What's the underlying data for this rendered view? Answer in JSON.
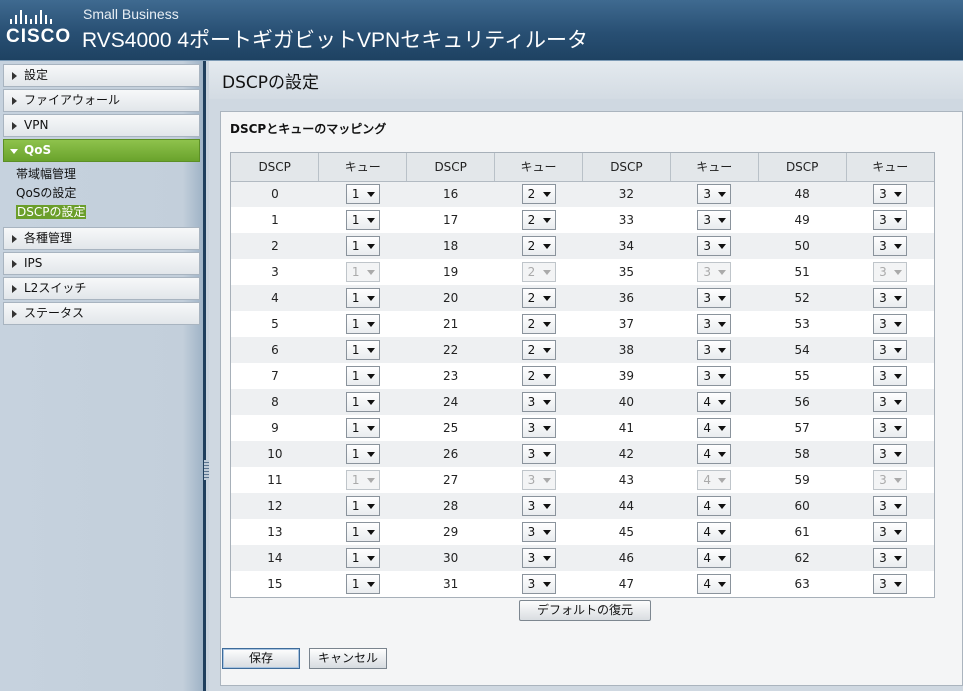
{
  "header": {
    "logo_text": "CISCO",
    "small_business": "Small Business",
    "product_title": "RVS4000 4ポートギガビットVPNセキュリティルータ"
  },
  "sidebar": {
    "items": [
      {
        "label": "設定"
      },
      {
        "label": "ファイアウォール"
      },
      {
        "label": "VPN"
      },
      {
        "label": "QoS"
      },
      {
        "label": "各種管理"
      },
      {
        "label": "IPS"
      },
      {
        "label": "L2スイッチ"
      },
      {
        "label": "ステータス"
      }
    ],
    "qos_sub": [
      {
        "label": "帯域幅管理"
      },
      {
        "label": "QoSの設定"
      },
      {
        "label": "DSCPの設定"
      }
    ]
  },
  "main": {
    "page_title": "DSCPの設定",
    "panel_title": "DSCPとキューのマッピング",
    "col_dscp": "DSCP",
    "col_queue": "キュー",
    "default_button": "デフォルトの復元",
    "save_button": "保存",
    "cancel_button": "キャンセル"
  },
  "rows": [
    {
      "cells": [
        {
          "dscp": "0",
          "q": "1",
          "disabled": false
        },
        {
          "dscp": "16",
          "q": "2",
          "disabled": false
        },
        {
          "dscp": "32",
          "q": "3",
          "disabled": false
        },
        {
          "dscp": "48",
          "q": "3",
          "disabled": false
        }
      ]
    },
    {
      "cells": [
        {
          "dscp": "1",
          "q": "1",
          "disabled": false
        },
        {
          "dscp": "17",
          "q": "2",
          "disabled": false
        },
        {
          "dscp": "33",
          "q": "3",
          "disabled": false
        },
        {
          "dscp": "49",
          "q": "3",
          "disabled": false
        }
      ]
    },
    {
      "cells": [
        {
          "dscp": "2",
          "q": "1",
          "disabled": false
        },
        {
          "dscp": "18",
          "q": "2",
          "disabled": false
        },
        {
          "dscp": "34",
          "q": "3",
          "disabled": false
        },
        {
          "dscp": "50",
          "q": "3",
          "disabled": false
        }
      ]
    },
    {
      "cells": [
        {
          "dscp": "3",
          "q": "1",
          "disabled": true
        },
        {
          "dscp": "19",
          "q": "2",
          "disabled": true
        },
        {
          "dscp": "35",
          "q": "3",
          "disabled": true
        },
        {
          "dscp": "51",
          "q": "3",
          "disabled": true
        }
      ]
    },
    {
      "cells": [
        {
          "dscp": "4",
          "q": "1",
          "disabled": false
        },
        {
          "dscp": "20",
          "q": "2",
          "disabled": false
        },
        {
          "dscp": "36",
          "q": "3",
          "disabled": false
        },
        {
          "dscp": "52",
          "q": "3",
          "disabled": false
        }
      ]
    },
    {
      "cells": [
        {
          "dscp": "5",
          "q": "1",
          "disabled": false
        },
        {
          "dscp": "21",
          "q": "2",
          "disabled": false
        },
        {
          "dscp": "37",
          "q": "3",
          "disabled": false
        },
        {
          "dscp": "53",
          "q": "3",
          "disabled": false
        }
      ]
    },
    {
      "cells": [
        {
          "dscp": "6",
          "q": "1",
          "disabled": false
        },
        {
          "dscp": "22",
          "q": "2",
          "disabled": false
        },
        {
          "dscp": "38",
          "q": "3",
          "disabled": false
        },
        {
          "dscp": "54",
          "q": "3",
          "disabled": false
        }
      ]
    },
    {
      "cells": [
        {
          "dscp": "7",
          "q": "1",
          "disabled": false
        },
        {
          "dscp": "23",
          "q": "2",
          "disabled": false
        },
        {
          "dscp": "39",
          "q": "3",
          "disabled": false
        },
        {
          "dscp": "55",
          "q": "3",
          "disabled": false
        }
      ]
    },
    {
      "cells": [
        {
          "dscp": "8",
          "q": "1",
          "disabled": false
        },
        {
          "dscp": "24",
          "q": "3",
          "disabled": false
        },
        {
          "dscp": "40",
          "q": "4",
          "disabled": false
        },
        {
          "dscp": "56",
          "q": "3",
          "disabled": false
        }
      ]
    },
    {
      "cells": [
        {
          "dscp": "9",
          "q": "1",
          "disabled": false
        },
        {
          "dscp": "25",
          "q": "3",
          "disabled": false
        },
        {
          "dscp": "41",
          "q": "4",
          "disabled": false
        },
        {
          "dscp": "57",
          "q": "3",
          "disabled": false
        }
      ]
    },
    {
      "cells": [
        {
          "dscp": "10",
          "q": "1",
          "disabled": false
        },
        {
          "dscp": "26",
          "q": "3",
          "disabled": false
        },
        {
          "dscp": "42",
          "q": "4",
          "disabled": false
        },
        {
          "dscp": "58",
          "q": "3",
          "disabled": false
        }
      ]
    },
    {
      "cells": [
        {
          "dscp": "11",
          "q": "1",
          "disabled": true
        },
        {
          "dscp": "27",
          "q": "3",
          "disabled": true
        },
        {
          "dscp": "43",
          "q": "4",
          "disabled": true
        },
        {
          "dscp": "59",
          "q": "3",
          "disabled": true
        }
      ]
    },
    {
      "cells": [
        {
          "dscp": "12",
          "q": "1",
          "disabled": false
        },
        {
          "dscp": "28",
          "q": "3",
          "disabled": false
        },
        {
          "dscp": "44",
          "q": "4",
          "disabled": false
        },
        {
          "dscp": "60",
          "q": "3",
          "disabled": false
        }
      ]
    },
    {
      "cells": [
        {
          "dscp": "13",
          "q": "1",
          "disabled": false
        },
        {
          "dscp": "29",
          "q": "3",
          "disabled": false
        },
        {
          "dscp": "45",
          "q": "4",
          "disabled": false
        },
        {
          "dscp": "61",
          "q": "3",
          "disabled": false
        }
      ]
    },
    {
      "cells": [
        {
          "dscp": "14",
          "q": "1",
          "disabled": false
        },
        {
          "dscp": "30",
          "q": "3",
          "disabled": false
        },
        {
          "dscp": "46",
          "q": "4",
          "disabled": false
        },
        {
          "dscp": "62",
          "q": "3",
          "disabled": false
        }
      ]
    },
    {
      "cells": [
        {
          "dscp": "15",
          "q": "1",
          "disabled": false
        },
        {
          "dscp": "31",
          "q": "3",
          "disabled": false
        },
        {
          "dscp": "47",
          "q": "4",
          "disabled": false
        },
        {
          "dscp": "63",
          "q": "3",
          "disabled": false
        }
      ]
    }
  ],
  "colors": {
    "header_bg": "#284f73",
    "active_nav": "#6aa32c",
    "selected_subnav": "#6b9e2a"
  }
}
